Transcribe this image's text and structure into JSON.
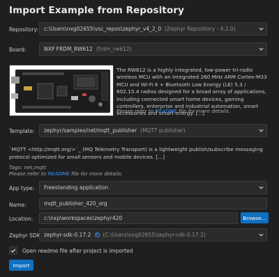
{
  "title": "Import Example from Repository",
  "repository": {
    "label": "Repository:",
    "value": "c:\\Users\\nxg02655\\vsc_repos\\zephyr_v4_2_0",
    "hint": "(Zephyr Repository - 4.2.0)"
  },
  "board": {
    "label": "Board:",
    "value": "NXP FRDM_RW612",
    "hint": "(frdm_rw612)",
    "description": "The RW612 is a highly integrated, low-power tri-radio wireless MCU with an integrated 260 MHz ARM Cortex-M33 MCU and Wi-Fi 6 + Bluetooth Low Energy (LE) 5.3 / 802.15.4 radios designed for a broad array of applications, including connected smart home devices, gaming controllers, enterprise and industrial automation, smart accessories and smart energy. [...]",
    "readme_prefix": "Please refer to ",
    "readme_link": "README",
    "readme_suffix": " file for more details."
  },
  "template": {
    "label": "Template:",
    "value": "zephyr/samples/net/mqtt_publisher",
    "hint": "(MQTT publisher)",
    "description": "`MQTT <http://mqtt.org/>`_ (MQ Telemetry Transport) is a lightweight publish/subscribe messaging protocol optimized for small sensors and mobile devices. [...]",
    "tags": "Tags: net,mqtt",
    "readme_prefix": "Please refer to ",
    "readme_link": "README",
    "readme_suffix": " file for more details."
  },
  "app_type": {
    "label": "App type:",
    "value": "Freestanding application"
  },
  "name": {
    "label": "Name:",
    "value": "mqtt_publisher_420_org"
  },
  "location": {
    "label": "Location:",
    "value": "c:\\nxp\\workspaces\\zephyr420",
    "browse_label": "Browse..."
  },
  "sdk": {
    "label": "Zephyr SDK:",
    "value": "zephyr-sdk-0.17.2",
    "hint": "(C:\\Users\\nxg02655\\zephyr-sdk-0.17.2)"
  },
  "open_readme": {
    "label": "Open readme file after project is imported",
    "checked": true
  },
  "import_label": "Import"
}
